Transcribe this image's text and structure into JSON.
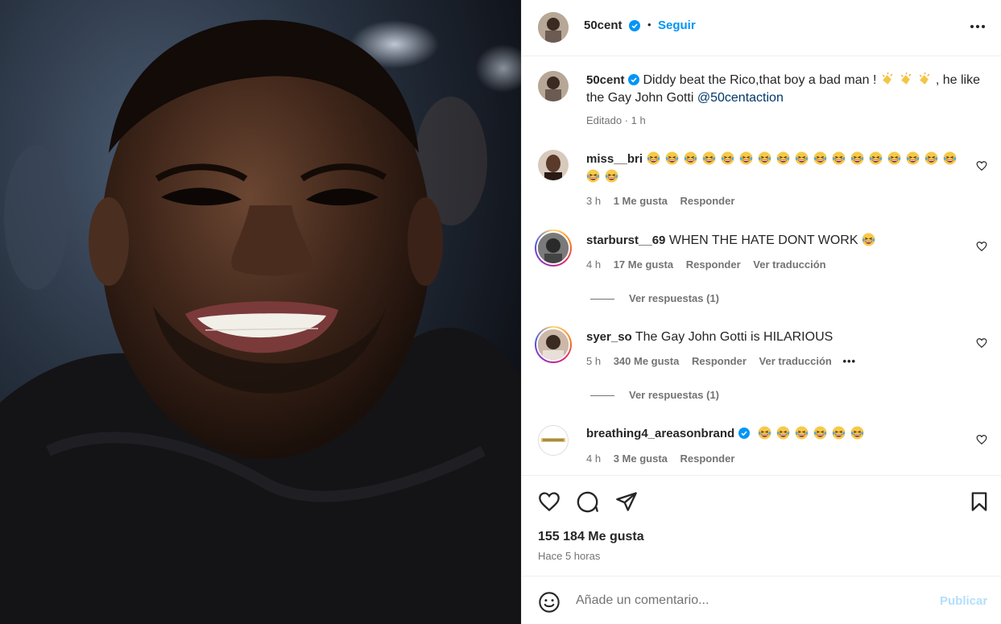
{
  "post": {
    "author": "50cent",
    "follow_label": "Seguir",
    "separator": "•",
    "caption_text": "Diddy beat the Rico,that boy a bad man !",
    "caption_tail": ", he like the Gay John Gotti",
    "caption_mention": "@50centaction",
    "caption_meta": "Editado · 1 h",
    "likes": "155 184 Me gusta",
    "time_ago": "Hace 5 horas"
  },
  "comments": [
    {
      "user": "miss__bri",
      "text": "",
      "emoji": "laughing-emoji",
      "emoji_count": 19,
      "time": "3 h",
      "likes": "1 Me gusta",
      "reply": "Responder",
      "translate": ""
    },
    {
      "user": "starburst__69",
      "text": "WHEN THE HATE DONT WORK",
      "emoji": "laughing-emoji",
      "emoji_count": 1,
      "time": "4 h",
      "likes": "17 Me gusta",
      "reply": "Responder",
      "translate": "Ver traducción",
      "view_replies": "Ver respuestas (1)"
    },
    {
      "user": "syer_so",
      "text": "The Gay John Gotti is HILARIOUS",
      "time": "5 h",
      "likes": "340 Me gusta",
      "reply": "Responder",
      "translate": "Ver traducción",
      "more": "•••",
      "view_replies": "Ver respuestas (1)"
    },
    {
      "user": "breathing4_areasonbrand",
      "verified": true,
      "text": "",
      "emoji": "laughing-emoji",
      "emoji_count": 6,
      "time": "4 h",
      "likes": "3 Me gusta",
      "reply": "Responder"
    }
  ],
  "footer": {
    "comment_placeholder": "Añade un comentario...",
    "publish_label": "Publicar"
  },
  "colors": {
    "accent": "#0095f6",
    "verified": "#0095f6",
    "publish_disabled": "#b2dffc",
    "muted": "#737373"
  },
  "icons": [
    "more-options-icon",
    "heart-icon",
    "comment-icon",
    "share-icon",
    "save-icon",
    "emoji-icon",
    "verified-badge-icon",
    "clapping-hands-emoji",
    "laughing-emoji"
  ]
}
